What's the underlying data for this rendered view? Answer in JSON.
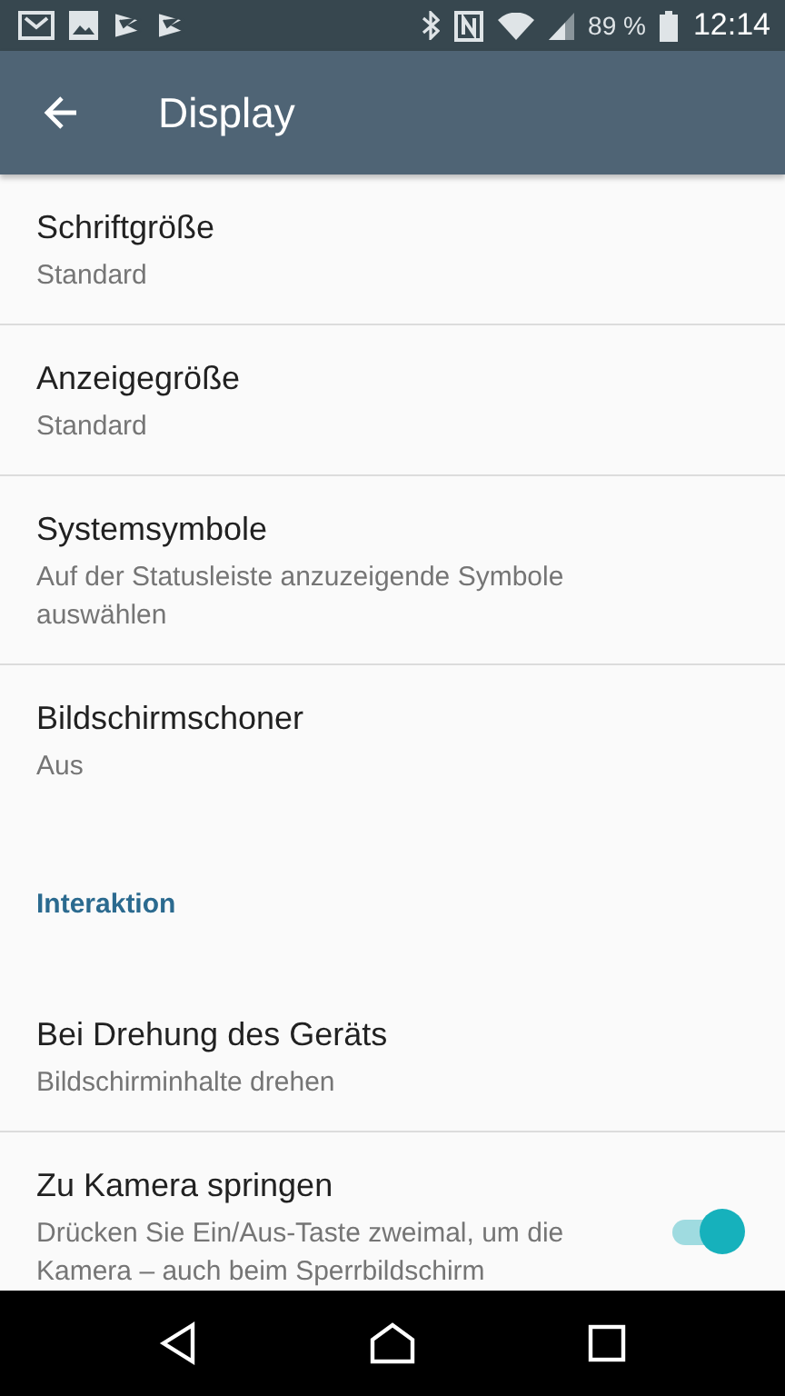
{
  "status_bar": {
    "battery_text": "89 %",
    "time": "12:14"
  },
  "app_bar": {
    "title": "Display"
  },
  "items": [
    {
      "kind": "setting",
      "title": "Schriftgröße",
      "summary": "Standard"
    },
    {
      "kind": "setting",
      "title": "Anzeigegröße",
      "summary": "Standard"
    },
    {
      "kind": "setting",
      "title": "Systemsymbole",
      "summary": "Auf der Statusleiste anzuzeigende Symbole auswählen"
    },
    {
      "kind": "setting",
      "title": "Bildschirmschoner",
      "summary": "Aus"
    },
    {
      "kind": "header",
      "title": "Interaktion"
    },
    {
      "kind": "setting",
      "title": "Bei Drehung des Geräts",
      "summary": "Bildschirminhalte drehen"
    },
    {
      "kind": "switch",
      "title": "Zu Kamera springen",
      "summary": "Drücken Sie Ein/Aus-Taste zweimal, um die Kamera – auch beim Sperrbildschirm",
      "checked": true
    }
  ]
}
